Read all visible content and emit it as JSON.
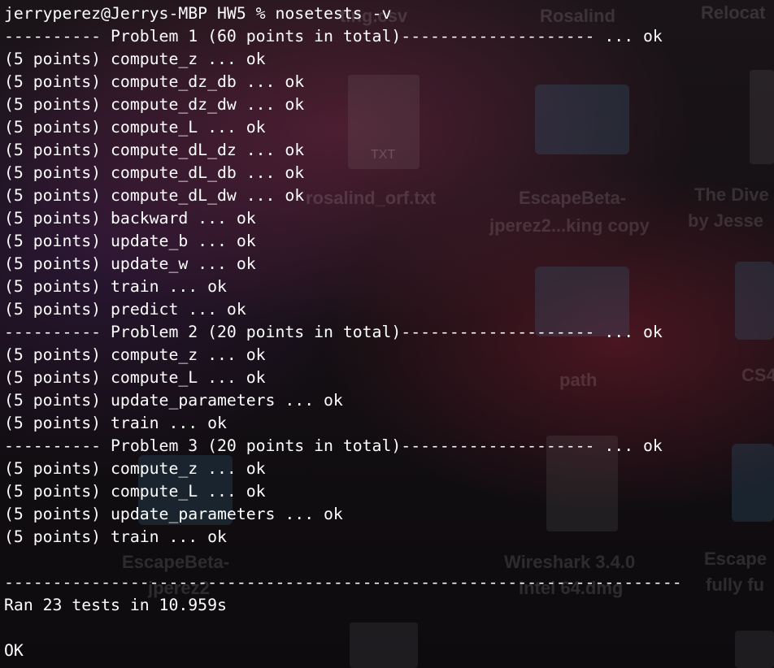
{
  "desktop": {
    "icons": [
      {
        "name": "ting.csv"
      },
      {
        "name": "Rosalind"
      },
      {
        "name": "Relocat"
      },
      {
        "name": "rosalind_orf.txt",
        "badge": "TXT"
      },
      {
        "name": "EscapeBeta-"
      },
      {
        "name": "jperez2...king copy"
      },
      {
        "name": "The Dive"
      },
      {
        "name": "by Jesse"
      },
      {
        "name": "path"
      },
      {
        "name": "CS4"
      },
      {
        "name": "EscapeBeta-"
      },
      {
        "name": "jperez2"
      },
      {
        "name": "Wireshark 3.4.0"
      },
      {
        "name": "Intel 64.dmg"
      },
      {
        "name": "Escape"
      },
      {
        "name": "fully fu"
      }
    ]
  },
  "terminal": {
    "prompt": "jerryperez@Jerrys-MBP HW5 % nosetests -v",
    "lines": [
      "---------- Problem 1 (60 points in total)-------------------- ... ok",
      "(5 points) compute_z ... ok",
      "(5 points) compute_dz_db ... ok",
      "(5 points) compute_dz_dw ... ok",
      "(5 points) compute_L ... ok",
      "(5 points) compute_dL_dz ... ok",
      "(5 points) compute_dL_db ... ok",
      "(5 points) compute_dL_dw ... ok",
      "(5 points) backward ... ok",
      "(5 points) update_b ... ok",
      "(5 points) update_w ... ok",
      "(5 points) train ... ok",
      "(5 points) predict ... ok",
      "---------- Problem 2 (20 points in total)-------------------- ... ok",
      "(5 points) compute_z ... ok",
      "(5 points) compute_L ... ok",
      "(5 points) update_parameters ... ok",
      "(5 points) train ... ok",
      "---------- Problem 3 (20 points in total)-------------------- ... ok",
      "(5 points) compute_z ... ok",
      "(5 points) compute_L ... ok",
      "(5 points) update_parameters ... ok",
      "(5 points) train ... ok",
      "",
      "----------------------------------------------------------------------",
      "Ran 23 tests in 10.959s",
      "",
      "OK"
    ]
  }
}
